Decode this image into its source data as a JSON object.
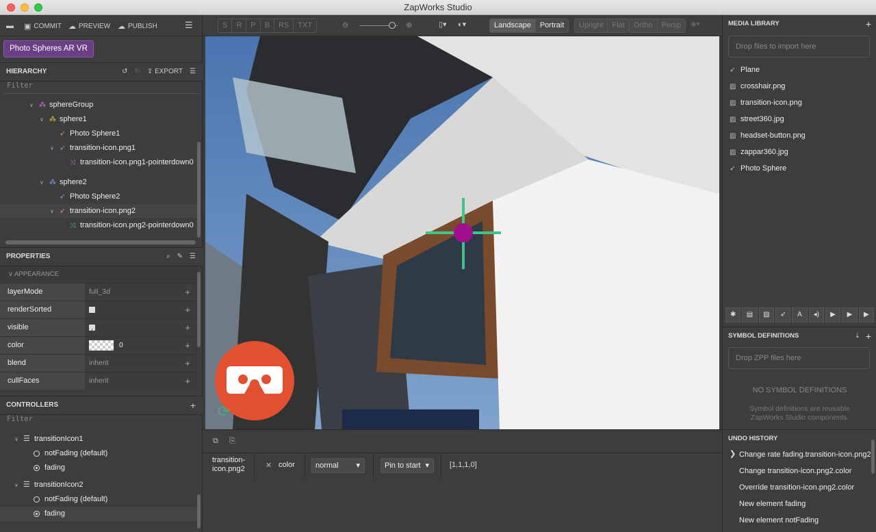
{
  "window": {
    "title": "ZapWorks Studio"
  },
  "toolbar": {
    "commit": "COMMIT",
    "preview": "PREVIEW",
    "publish": "PUBLISH"
  },
  "project": {
    "name": "Photo Spheres AR VR"
  },
  "hierarchy": {
    "title": "HIERARCHY",
    "export": "EXPORT",
    "filter_placeholder": "Filter",
    "nodes": [
      {
        "label": "sphereGroup"
      },
      {
        "label": "sphere1"
      },
      {
        "label": "Photo Sphere1"
      },
      {
        "label": "transition-icon.png1"
      },
      {
        "label": "transition-icon.png1-pointerdown0"
      },
      {
        "label": "sphere2"
      },
      {
        "label": "Photo Sphere2"
      },
      {
        "label": "transition-icon.png2"
      },
      {
        "label": "transition-icon.png2-pointerdown0"
      }
    ]
  },
  "properties": {
    "title": "PROPERTIES",
    "group": "APPEARANCE",
    "rows": [
      {
        "name": "layerMode",
        "value": "full_3d"
      },
      {
        "name": "renderSorted",
        "value": ""
      },
      {
        "name": "visible",
        "value": ""
      },
      {
        "name": "color",
        "value": "0"
      },
      {
        "name": "blend",
        "value": "inherit"
      },
      {
        "name": "cullFaces",
        "value": "inherit"
      }
    ]
  },
  "controllers": {
    "title": "CONTROLLERS",
    "filter_placeholder": "Filter",
    "items": [
      {
        "label": "transitionIcon1"
      },
      {
        "label": "notFading (default)"
      },
      {
        "label": "fading"
      },
      {
        "label": "transitionIcon2"
      },
      {
        "label": "notFading (default)"
      },
      {
        "label": "fading"
      }
    ]
  },
  "viewport_toolbar": {
    "modes": [
      "S",
      "R",
      "P",
      "B",
      "RS",
      "TXT"
    ],
    "orientation": [
      "Landscape",
      "Portrait"
    ],
    "view": [
      "Upright",
      "Flat"
    ],
    "camera": [
      "Ortho",
      "Persp"
    ],
    "zoom_fraction": 0.86
  },
  "timeline": {
    "element": "transition-icon.png2",
    "property": "color",
    "mode": "normal",
    "pin": "Pin to start",
    "value": "[1,1,1,0]"
  },
  "media_library": {
    "title": "MEDIA LIBRARY",
    "dropzone": "Drop files to import here",
    "items": [
      {
        "label": "Plane",
        "icon": "rocket-icon"
      },
      {
        "label": "crosshair.png",
        "icon": "image-icon"
      },
      {
        "label": "transition-icon.png",
        "icon": "image-icon"
      },
      {
        "label": "street360.jpg",
        "icon": "image-icon"
      },
      {
        "label": "headset-button.png",
        "icon": "image-icon"
      },
      {
        "label": "zappar360.jpg",
        "icon": "image-icon"
      },
      {
        "label": "Photo Sphere",
        "icon": "rocket-icon"
      }
    ]
  },
  "symbols": {
    "title": "SYMBOL DEFINITIONS",
    "dropzone": "Drop ZPP files here",
    "empty_title": "NO SYMBOL DEFINITIONS",
    "empty_desc1": "Symbol definitions are reusable",
    "empty_desc2": "ZapWorks Studio components."
  },
  "undo": {
    "title": "UNDO HISTORY",
    "items": [
      "Change rate fading.transition-icon.png2",
      "Change transition-icon.png2.color",
      "Override transition-icon.png2.color",
      "New element fading",
      "New element notFading"
    ]
  },
  "colors": {
    "accent_purple": "#6b3f86",
    "crosshair_green": "#3fc48a",
    "crosshair_dot": "#a0108f",
    "vr_button": "#e2502f"
  }
}
